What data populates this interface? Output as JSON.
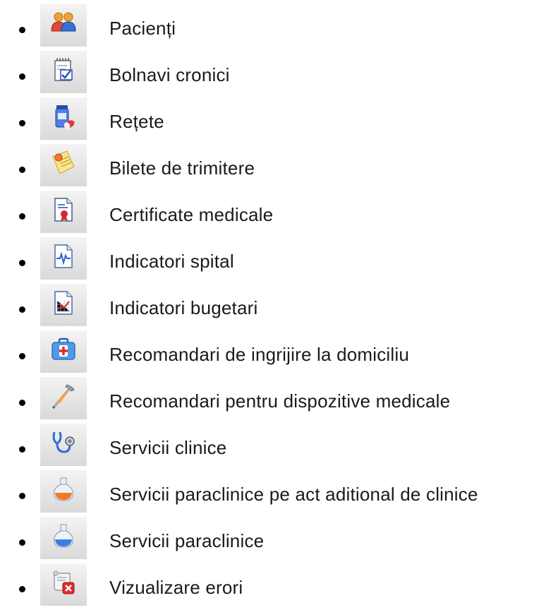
{
  "menu": {
    "items": [
      {
        "label": "Pacienți",
        "icon": "patients-icon"
      },
      {
        "label": "Bolnavi cronici",
        "icon": "chronic-patients-icon"
      },
      {
        "label": "Rețete",
        "icon": "prescription-icon"
      },
      {
        "label": "Bilete de trimitere",
        "icon": "referral-ticket-icon"
      },
      {
        "label": "Certificate medicale",
        "icon": "medical-certificate-icon"
      },
      {
        "label": " Indicatori spital",
        "icon": "hospital-indicators-icon"
      },
      {
        "label": "Indicatori bugetari",
        "icon": "budget-indicators-icon"
      },
      {
        "label": "Recomandari de ingrijire la domiciliu",
        "icon": "home-care-icon"
      },
      {
        "label": "Recomandari pentru dispozitive medicale",
        "icon": "crutch-icon"
      },
      {
        "label": "Servicii clinice",
        "icon": "stethoscope-icon"
      },
      {
        "label": "Servicii paraclinice pe act aditional de clinice",
        "icon": "flask-orange-icon"
      },
      {
        "label": "Servicii paraclinice",
        "icon": "flask-blue-icon"
      },
      {
        "label": "Vizualizare erori",
        "icon": "error-scroll-icon"
      }
    ]
  }
}
